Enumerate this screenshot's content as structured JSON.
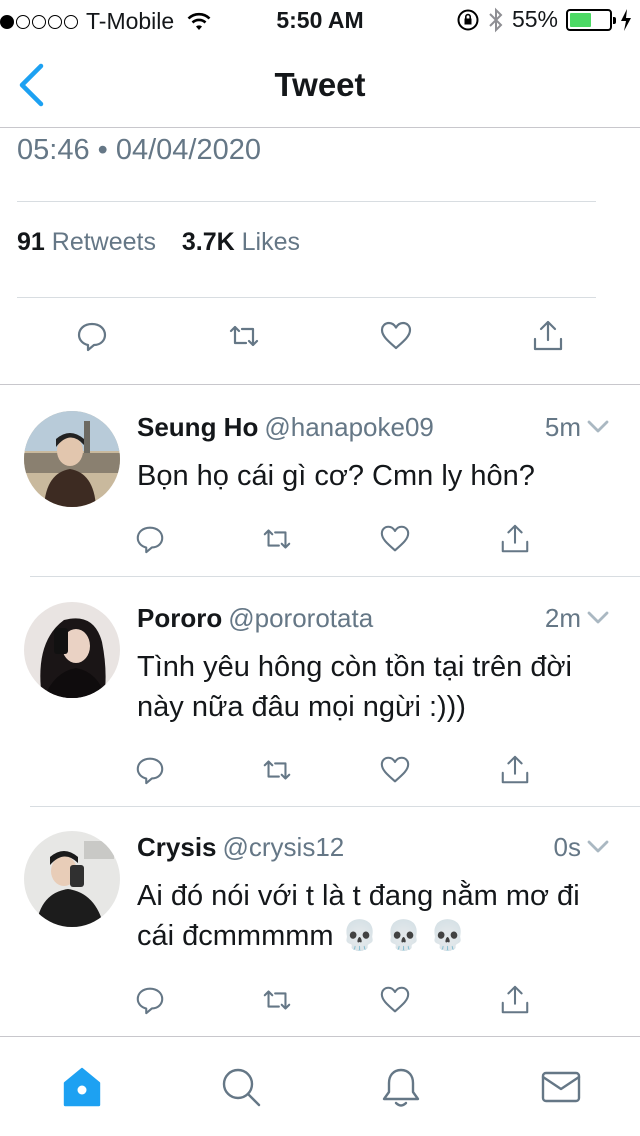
{
  "status_bar": {
    "carrier": "T-Mobile",
    "signal_bars": 1,
    "time": "5:50 AM",
    "battery_percent": "55%",
    "battery_level": 0.55
  },
  "nav": {
    "title": "Tweet",
    "back_icon": "chevron-left-icon"
  },
  "tweet": {
    "timestamp": "05:46 • 04/04/2020",
    "retweets_count": "91",
    "retweets_label": "Retweets",
    "likes_count": "3.7K",
    "likes_label": "Likes"
  },
  "replies": [
    {
      "name": "Seung Ho",
      "handle": "@hanapoke09",
      "ago": "5m",
      "text": "Bọn họ cái gì cơ? Cmn ly hôn?"
    },
    {
      "name": "Pororo",
      "handle": "@pororotata",
      "ago": "2m",
      "text": "Tình yêu hông còn tồn tại trên đời này nữa đâu mọi ngừi :)))"
    },
    {
      "name": "Crysis",
      "handle": "@crysis12",
      "ago": "0s",
      "text": "Ai đó nói với t là t đang nằm mơ đi cái đcmmmmm 💀 💀 💀"
    }
  ],
  "tabbar": {
    "items": [
      "home-icon",
      "search-icon",
      "notifications-icon",
      "messages-icon"
    ],
    "active": "home-icon"
  },
  "colors": {
    "accent": "#1da1f2",
    "secondary_text": "#657786",
    "primary_text": "#14171a"
  }
}
